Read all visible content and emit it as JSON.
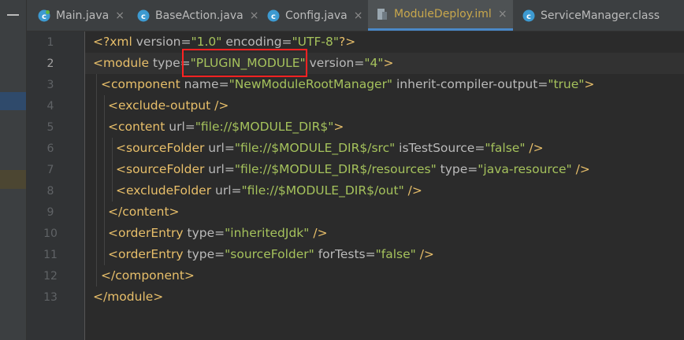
{
  "tabs": [
    {
      "label": "Main.java",
      "icon": "java-class-icon",
      "active": false
    },
    {
      "label": "BaseAction.java",
      "icon": "java-class-icon",
      "active": false
    },
    {
      "label": "Config.java",
      "icon": "java-class-icon",
      "active": false
    },
    {
      "label": "ModuleDeploy.iml",
      "icon": "module-file-icon",
      "active": true
    },
    {
      "label": "ServiceManager.class",
      "icon": "java-class-icon",
      "active": false
    }
  ],
  "tab_close_glyph": "×",
  "line_numbers": [
    "1",
    "2",
    "3",
    "4",
    "5",
    "6",
    "7",
    "8",
    "9",
    "10",
    "11",
    "12",
    "13"
  ],
  "code": {
    "l1": {
      "open": "<?xml ",
      "a1": "version",
      "eq": "=",
      "v1": "\"1.0\"",
      "a2": " encoding",
      "v2": "\"UTF-8\"",
      "close": "?>"
    },
    "l2": {
      "open": "<module ",
      "a1": "type",
      "v1": "\"PLUGIN_MODULE\"",
      "a2": " version",
      "v2": "\"4\"",
      "close": ">"
    },
    "l3": {
      "open": "<component ",
      "a1": "name",
      "v1": "\"NewModuleRootManager\"",
      "a2": " inherit-compiler-output",
      "v2": "\"true\"",
      "close": ">"
    },
    "l4": {
      "text": "<exclude-output />"
    },
    "l5": {
      "open": "<content ",
      "a1": "url",
      "v1": "\"file://$MODULE_DIR$\"",
      "close": ">"
    },
    "l6": {
      "open": "<sourceFolder ",
      "a1": "url",
      "v1": "\"file://$MODULE_DIR$/src\"",
      "a2": " isTestSource",
      "v2": "\"false\"",
      "close": " />"
    },
    "l7": {
      "open": "<sourceFolder ",
      "a1": "url",
      "v1": "\"file://$MODULE_DIR$/resources\"",
      "a2": " type",
      "v2": "\"java-resource\"",
      "close": " />"
    },
    "l8": {
      "open": "<excludeFolder ",
      "a1": "url",
      "v1": "\"file://$MODULE_DIR$/out\"",
      "close": " />"
    },
    "l9": {
      "text": "</content>"
    },
    "l10": {
      "open": "<orderEntry ",
      "a1": "type",
      "v1": "\"inheritedJdk\"",
      "close": " />"
    },
    "l11": {
      "open": "<orderEntry ",
      "a1": "type",
      "v1": "\"sourceFolder\"",
      "a2": " forTests",
      "v2": "\"false\"",
      "close": " />"
    },
    "l12": {
      "text": "</component>"
    },
    "l13": {
      "text": "</module>"
    }
  },
  "colors": {
    "tag": "#e8bf6a",
    "attribute": "#bababa",
    "string": "#a5c25c",
    "highlight_box": "#ff2222",
    "active_tab_text": "#c8a74c",
    "active_tab_underline": "#4a88c7"
  }
}
